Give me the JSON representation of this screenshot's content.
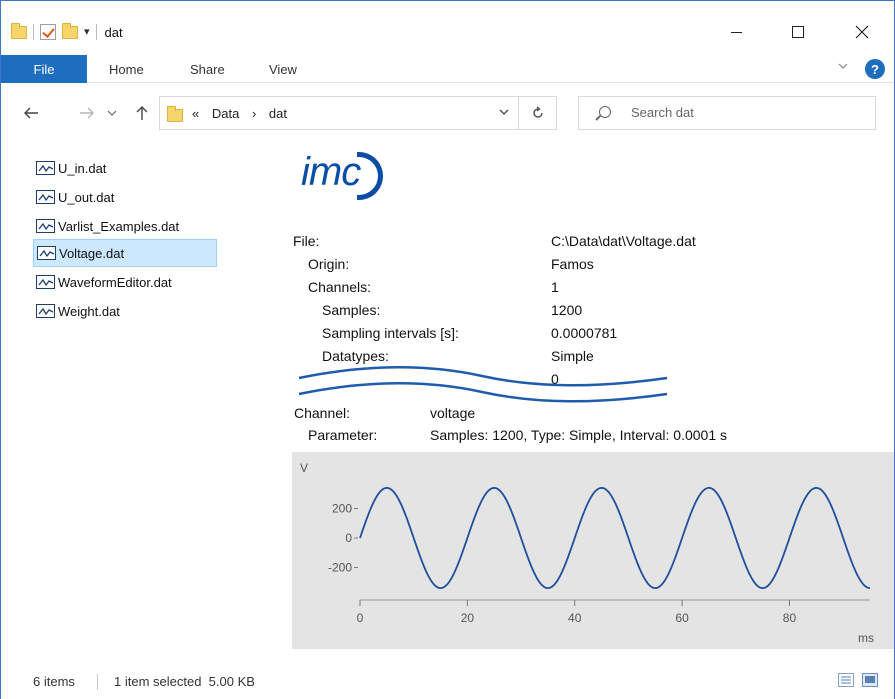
{
  "window": {
    "title": "dat",
    "qat_dropdown": "▾"
  },
  "ribbon": {
    "tabs": [
      "File",
      "Home",
      "Share",
      "View"
    ]
  },
  "nav": {
    "breadcrumb_overflow": "«",
    "path": [
      "Data",
      "dat"
    ],
    "path_separator": "›",
    "search_placeholder": "Search dat"
  },
  "files": [
    {
      "name": "U_in.dat",
      "selected": false
    },
    {
      "name": "U_out.dat",
      "selected": false
    },
    {
      "name": "Varlist_Examples.dat",
      "selected": false
    },
    {
      "name": "Voltage.dat",
      "selected": true
    },
    {
      "name": "WaveformEditor.dat",
      "selected": false
    },
    {
      "name": "Weight.dat",
      "selected": false
    }
  ],
  "preview": {
    "logo": "imc",
    "file_label": "File:",
    "file_value": "C:\\Data\\dat\\Voltage.dat",
    "origin_label": "Origin:",
    "origin_value": "Famos",
    "channels_label": "Channels:",
    "channels_value": "1",
    "samples_label": "Samples:",
    "samples_value": "1200",
    "interval_label": "Sampling intervals [s]:",
    "interval_value": "0.0000781",
    "datatypes_label": "Datatypes:",
    "datatypes_value": "Simple",
    "cut_value": "0",
    "channel_label": "Channel:",
    "channel_value": "voltage",
    "parameter_label": "Parameter:",
    "parameter_value": "Samples: 1200, Type: Simple, Interval: 0.0001 s"
  },
  "chart_data": {
    "type": "line",
    "ylabel": "V",
    "xlabel": "ms",
    "xlim": [
      0,
      95
    ],
    "ylim": [
      -380,
      380
    ],
    "xticks": [
      0,
      20,
      40,
      60,
      80
    ],
    "yticks": [
      200,
      0,
      -200
    ],
    "ytick_labels": [
      "200",
      "0",
      "-200"
    ],
    "series": [
      {
        "function": "sine",
        "amplitude": 340,
        "period_ms": 20,
        "phase_deg": 0,
        "color": "#1f4e9c"
      }
    ],
    "background": "#e4e4e4"
  },
  "status": {
    "items_count": "6 items",
    "selection": "1 item selected  5.00 KB"
  },
  "colors": {
    "accent": "#1e6ebf",
    "selection_bg": "#cce8ff",
    "logo_blue": "#0c4ea5",
    "wave_blue": "#1f4e9c"
  }
}
